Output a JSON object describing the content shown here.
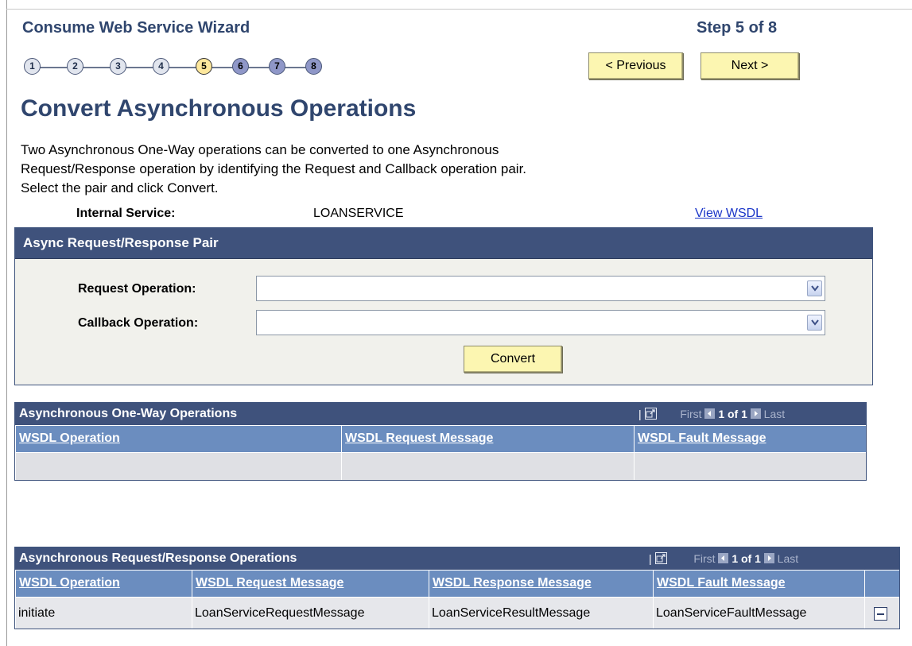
{
  "wizard": {
    "title": "Consume Web Service Wizard",
    "step_text": "Step 5 of 8",
    "steps": [
      "1",
      "2",
      "3",
      "4",
      "5",
      "6",
      "7",
      "8"
    ],
    "current_step": 5,
    "prev_label": "< Previous",
    "next_label": "Next >"
  },
  "page": {
    "title": "Convert Asynchronous Operations",
    "description": [
      "Two Asynchronous One-Way operations can be converted to one Asynchronous",
      "Request/Response operation by identifying the Request and Callback operation pair.",
      "Select the pair and click Convert."
    ],
    "internal_service_label": "Internal Service:",
    "internal_service_value": "LOANSERVICE",
    "view_wsdl_label": "View WSDL"
  },
  "pair_section": {
    "header": "Async Request/Response Pair",
    "request_label": "Request Operation:",
    "request_value": "",
    "callback_label": "Callback Operation:",
    "callback_value": "",
    "convert_label": "Convert"
  },
  "oneway_grid": {
    "title": "Asynchronous One-Way Operations",
    "nav": {
      "first": "First",
      "count": "1 of 1",
      "last": "Last"
    },
    "columns": [
      "WSDL Operation",
      "WSDL Request Message",
      "WSDL Fault Message"
    ],
    "rows": [
      [
        "",
        "",
        ""
      ]
    ]
  },
  "reqresp_grid": {
    "title": "Asynchronous Request/Response Operations",
    "nav": {
      "first": "First",
      "count": "1 of 1",
      "last": "Last"
    },
    "columns": [
      "WSDL Operation",
      "WSDL Request Message",
      "WSDL Response Message",
      "WSDL Fault Message"
    ],
    "rows": [
      [
        "initiate",
        "LoanServiceRequestMessage",
        "LoanServiceResultMessage",
        "LoanServiceFaultMessage"
      ]
    ]
  },
  "colors": {
    "title_blue": "#30466e",
    "header_bg": "#3f527c",
    "col_header_bg": "#6b8dbf",
    "button_yellow": "#fcf6b1",
    "current_step": "#fde79c",
    "future_step": "#8f97c8"
  }
}
